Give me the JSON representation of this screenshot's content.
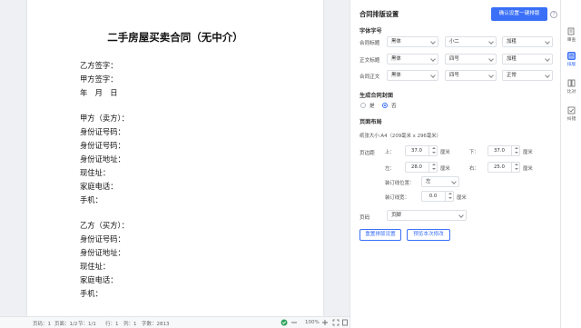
{
  "document": {
    "title": "二手房屋买卖合同（无中介）",
    "lines": [
      "乙方签字：",
      "甲方签字：",
      "年　月　日",
      "甲方（卖方）：",
      "身份证号码：",
      "身份证号码：",
      "身份证地址：",
      "现住址：",
      "家庭电话：",
      "手机：",
      "乙方（买方）：",
      "身份证号码：",
      "身份证地址：",
      "现住址：",
      "家庭电话：",
      "手机："
    ]
  },
  "status_bar": {
    "page_no": "页码：1",
    "page_count": "页面：1/2",
    "section": "节：1/1",
    "row": "行：1",
    "col": "列：1",
    "word_count": "字数：2813",
    "zoom": "100%"
  },
  "panel": {
    "title": "合同排版设置",
    "apply_button": "确认设置一键排版",
    "font_section": "字体字号",
    "font_rows": [
      {
        "label": "合同标题",
        "font": "黑体",
        "size": "小二",
        "weight": "加粗"
      },
      {
        "label": "正文标题",
        "font": "黑体",
        "size": "四号",
        "weight": "加粗"
      },
      {
        "label": "合同正文",
        "font": "黑体",
        "size": "四号",
        "weight": "正常"
      }
    ],
    "cover_section": "生成合同封面",
    "cover_yes": "是",
    "cover_no": "否",
    "layout_section": "页面布局",
    "paper_size": "纸张大小:A4（209毫米 x 296毫米）",
    "margin_label": "页边距",
    "margins": [
      {
        "label": "上：",
        "value": "37.0",
        "unit": "厘米"
      },
      {
        "label": "下：",
        "value": "37.0",
        "unit": "厘米"
      },
      {
        "label": "左：",
        "value": "28.0",
        "unit": "厘米"
      },
      {
        "label": "右：",
        "value": "25.0",
        "unit": "厘米"
      }
    ],
    "gutter_pos_label": "装订线位置：",
    "gutter_pos_value": "左",
    "gutter_width_label": "装订线宽：",
    "gutter_width_value": "0.0",
    "gutter_width_unit": "厘米",
    "header_label": "页码",
    "header_value": "页脚",
    "reset_button": "重置排版设置",
    "preview_button": "预览本次修改"
  },
  "rail": {
    "items": [
      {
        "label": "审查",
        "icon": "review-icon"
      },
      {
        "label": "排版",
        "icon": "layout-icon"
      },
      {
        "label": "比对",
        "icon": "compare-icon"
      },
      {
        "label": "纠错",
        "icon": "proofread-icon"
      }
    ]
  },
  "colors": {
    "accent": "#3a6ff7"
  }
}
